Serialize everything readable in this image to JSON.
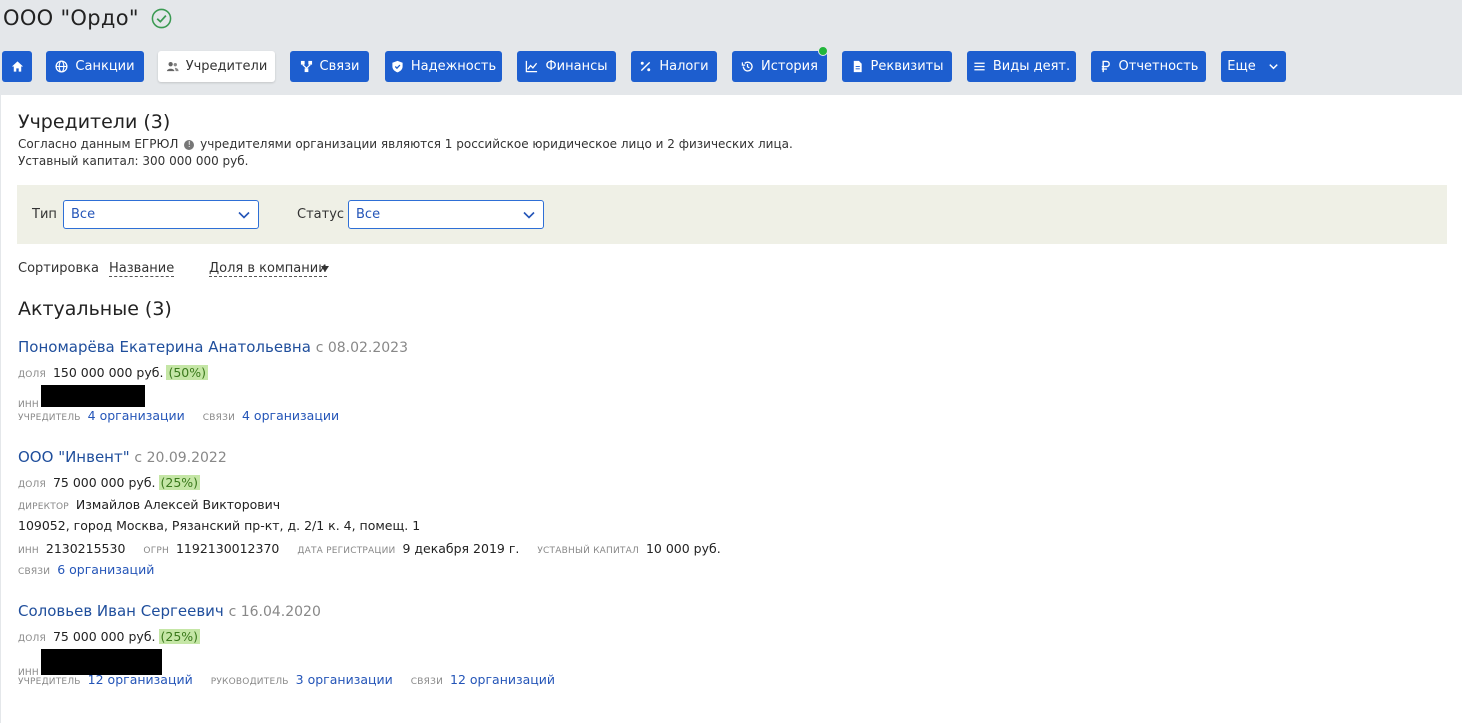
{
  "company": {
    "title": "ООО \"Ордо\""
  },
  "tabs": [
    {
      "name": "tab-home",
      "label": "",
      "icon": "home-icon"
    },
    {
      "name": "tab-sanctions",
      "label": "Санкции",
      "icon": "globe-icon"
    },
    {
      "name": "tab-founders",
      "label": "Учредители",
      "icon": "people-icon",
      "active": true
    },
    {
      "name": "tab-links",
      "label": "Связи",
      "icon": "network-icon"
    },
    {
      "name": "tab-reliability",
      "label": "Надежность",
      "icon": "shield-icon"
    },
    {
      "name": "tab-finance",
      "label": "Финансы",
      "icon": "chart-icon"
    },
    {
      "name": "tab-taxes",
      "label": "Налоги",
      "icon": "percent-icon"
    },
    {
      "name": "tab-history",
      "label": "История",
      "icon": "history-icon"
    },
    {
      "name": "tab-requisites",
      "label": "Реквизиты",
      "icon": "document-icon"
    },
    {
      "name": "tab-activities",
      "label": "Виды деят.",
      "icon": "list-icon"
    },
    {
      "name": "tab-reports",
      "label": "Отчетность",
      "icon": "ruble-icon"
    },
    {
      "name": "tab-more",
      "label": "Еще",
      "icon": "chevron-down-icon"
    }
  ],
  "section": {
    "title": "Учредители (3)",
    "note_prefix": "Согласно данным ЕГРЮЛ",
    "note_suffix": "учредителями организации являются 1 российское юридическое лицо и 2 физических лица.",
    "capital": "Уставный капитал: 300 000 000 руб."
  },
  "filters": {
    "type_label": "Тип",
    "type_value": "Все",
    "status_label": "Статус",
    "status_value": "Все"
  },
  "sort": {
    "label": "Сортировка",
    "by_name": "Название",
    "by_share": "Доля в компании"
  },
  "group": {
    "title": "Актуальные (3)"
  },
  "labels": {
    "share": "доля",
    "inn": "инн",
    "founder": "учредитель",
    "links": "связи",
    "director": "директор",
    "ogrn": "огрн",
    "reg_date": "дата регистрации",
    "capital": "уставный капитал",
    "head": "руководитель"
  },
  "founders": [
    {
      "name": "Пономарёва Екатерина Анатольевна",
      "since": "с 08.02.2023",
      "share": "150 000 000 руб.",
      "percent": "(50%)",
      "founder_link": "4 организации",
      "links_link": "4 организации"
    },
    {
      "name": "ООО \"Инвент\"",
      "since": "с 20.09.2022",
      "share": "75 000 000 руб.",
      "percent": "(25%)",
      "director": "Измайлов Алексей Викторович",
      "address": "109052, город Москва, Рязанский пр-кт, д. 2/1 к. 4, помещ. 1",
      "inn": "2130215530",
      "ogrn": "1192130012370",
      "reg_date": "9 декабря 2019 г.",
      "capital": "10 000 руб.",
      "links_link": "6 организаций"
    },
    {
      "name": "Соловьев Иван Сергеевич",
      "since": "с 16.04.2020",
      "share": "75 000 000 руб.",
      "percent": "(25%)",
      "founder_link": "12 организаций",
      "head_link": "3 организации",
      "links_link": "12 организаций"
    }
  ]
}
